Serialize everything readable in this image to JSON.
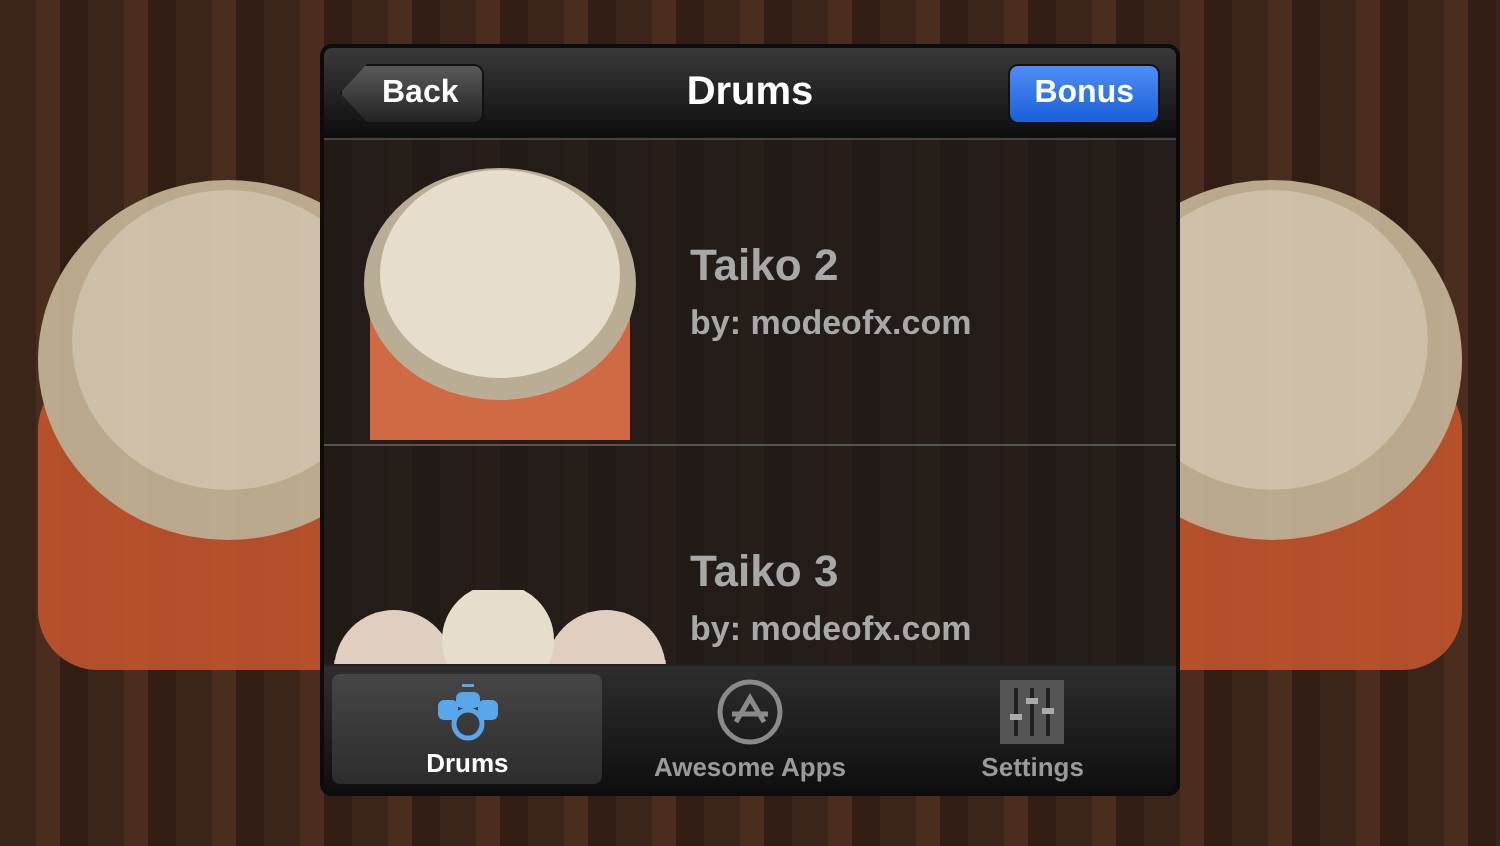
{
  "nav_bar": {
    "back_button": "Back",
    "title": "Drums",
    "bonus_button": "Bonus"
  },
  "drums": [
    {
      "name": "Taiko 2",
      "author": "by: modeofx.com",
      "kind": "single"
    },
    {
      "name": "Taiko 3",
      "author": "by: modeofx.com",
      "kind": "set"
    }
  ],
  "tabs": [
    {
      "label": "Drums",
      "kind": "drums",
      "selected": true
    },
    {
      "label": "Awesome Apps",
      "kind": "apps",
      "selected": false
    },
    {
      "label": "Settings",
      "kind": "settings",
      "selected": false
    }
  ]
}
